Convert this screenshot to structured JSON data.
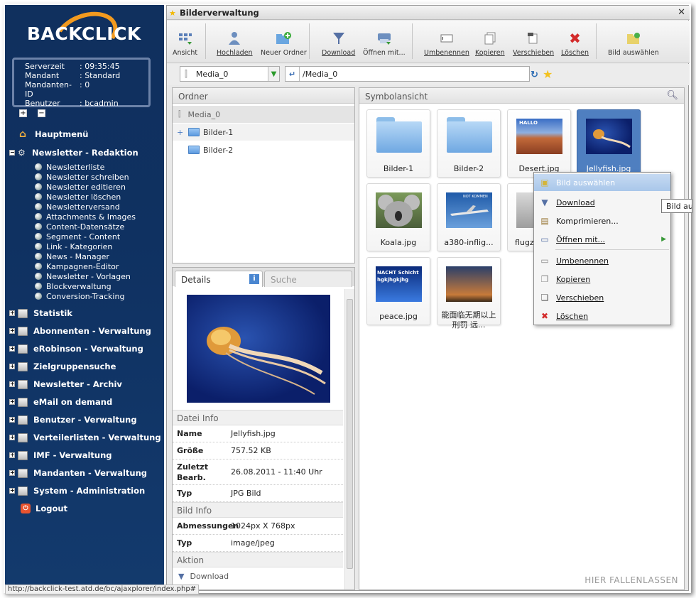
{
  "logo": {
    "text": "BACKCLICK"
  },
  "server_info": {
    "rows": [
      {
        "k": "Serverzeit",
        "v": ": 09:35:45"
      },
      {
        "k": "Mandant",
        "v": ": Standard"
      },
      {
        "k": "Mandanten-ID",
        "v": ": 0"
      },
      {
        "k": "Benutzer",
        "v": ": bcadmin"
      }
    ]
  },
  "sidebar": {
    "hauptmenu": "Hauptmenü",
    "newsletter_redaktion": "Newsletter - Redaktion",
    "sub_items": [
      "Newsletterliste",
      "Newsletter schreiben",
      "Newsletter editieren",
      "Newsletter löschen",
      "Newsletterversand",
      "Attachments & Images",
      "Content-Datensätze",
      "Segment - Content",
      "Link - Kategorien",
      "News - Manager",
      "Kampagnen-Editor",
      "Newsletter - Vorlagen",
      "Blockverwaltung",
      "Conversion-Tracking"
    ],
    "sections": [
      "Statistik",
      "Abonnenten - Verwaltung",
      "eRobinson - Verwaltung",
      "Zielgruppensuche",
      "Newsletter - Archiv",
      "eMail on demand",
      "Benutzer - Verwaltung",
      "Verteilerlisten - Verwaltung",
      "IMF - Verwaltung",
      "Mandanten - Verwaltung",
      "System - Administration"
    ],
    "logout": "Logout",
    "expand_glyph": "+",
    "collapse_glyph": "−",
    "open_glyph": "−"
  },
  "window": {
    "title": "Bilderverwaltung"
  },
  "toolbar": {
    "ansicht": "Ansicht",
    "hochladen": "Hochladen",
    "neuer_ordner": "Neuer Ordner",
    "download": "Download",
    "oeffnen": "Öffnen mit...",
    "umbenennen": "Umbenennen",
    "kopieren": "Kopieren",
    "verschieben": "Verschieben",
    "loeschen": "Löschen",
    "bild_auswaehlen": "Bild auswählen"
  },
  "pathbar": {
    "repository": "Media_0",
    "path": "/Media_0"
  },
  "folders": {
    "header": "Ordner",
    "root": "Media_0",
    "items": [
      "Bilder-1",
      "Bilder-2"
    ]
  },
  "details": {
    "tab_details": "Details",
    "tab_suche": "Suche",
    "datei_info": "Datei Info",
    "file_rows": [
      {
        "k": "Name",
        "v": "Jellyfish.jpg"
      },
      {
        "k": "Größe",
        "v": "757.52 KB"
      },
      {
        "k": "Zuletzt Bearb.",
        "v": "26.08.2011 - 11:40 Uhr"
      },
      {
        "k": "Typ",
        "v": "JPG Bild"
      }
    ],
    "bild_info": "Bild Info",
    "image_rows": [
      {
        "k": "Abmessungen",
        "v": "1024px X 768px"
      },
      {
        "k": "Typ",
        "v": "image/jpeg"
      }
    ],
    "aktion": "Aktion",
    "action_download": "Download"
  },
  "symbol": {
    "header": "Symbolansicht",
    "items": [
      "Bilder-1",
      "Bilder-2",
      "Desert.jpg",
      "Jellyfish.jpg",
      "Koala.jpg",
      "a380-inflig...",
      "flugze",
      "peace.jpg",
      "能面临无期以上刑罚 远..."
    ],
    "desert_label": "HALLO",
    "a380_label": "NOT KOMMEN",
    "peace_label": "NACHT Schicht hgkjhgkjhg",
    "drop": "HIER FALLENLASSEN"
  },
  "context_menu": {
    "bild_auswaehlen": "Bild auswählen",
    "download": "Download",
    "komprimieren": "Komprimieren...",
    "oeffnen": "Öffnen mit...",
    "umbenennen": "Umbenennen",
    "kopieren": "Kopieren",
    "verschieben": "Verschieben",
    "loeschen": "Löschen"
  },
  "tooltip": "Bild auswählen",
  "status_url": "http://backclick-test.atd.de/bc/ajaxplorer/index.php#"
}
